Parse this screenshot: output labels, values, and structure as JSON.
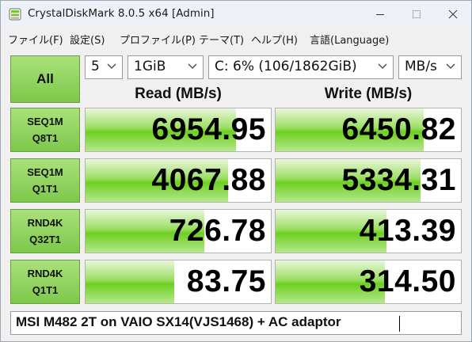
{
  "window": {
    "title": "CrystalDiskMark 8.0.5 x64 [Admin]"
  },
  "menu": [
    {
      "label": "ファイル(F)"
    },
    {
      "label": "設定(S)"
    },
    {
      "label": "プロファイル(P)"
    },
    {
      "label": "テーマ(T)"
    },
    {
      "label": "ヘルプ(H)"
    },
    {
      "label": "言語(Language)"
    }
  ],
  "controls": {
    "all_label": "All",
    "count": "5",
    "size": "1GiB",
    "drive": "C: 6% (106/1862GiB)",
    "unit": "MB/s"
  },
  "headers": {
    "read": "Read (MB/s)",
    "write": "Write (MB/s)"
  },
  "results": [
    {
      "line1": "SEQ1M",
      "line2": "Q8T1",
      "read": "6954.95",
      "write": "6450.82",
      "read_fill": 0.81,
      "write_fill": 0.8
    },
    {
      "line1": "SEQ1M",
      "line2": "Q1T1",
      "read": "4067.88",
      "write": "5334.31",
      "read_fill": 0.77,
      "write_fill": 0.78
    },
    {
      "line1": "RND4K",
      "line2": "Q32T1",
      "read": "726.78",
      "write": "413.39",
      "read_fill": 0.64,
      "write_fill": 0.6
    },
    {
      "line1": "RND4K",
      "line2": "Q1T1",
      "read": "83.75",
      "write": "314.50",
      "read_fill": 0.48,
      "write_fill": 0.59
    }
  ],
  "comment": "MSI M482 2T on VAIO SX14(VJS1468) + AC adaptor",
  "colors": {
    "accent_green": "#6dcf22",
    "button_green": "#8fd45c"
  }
}
